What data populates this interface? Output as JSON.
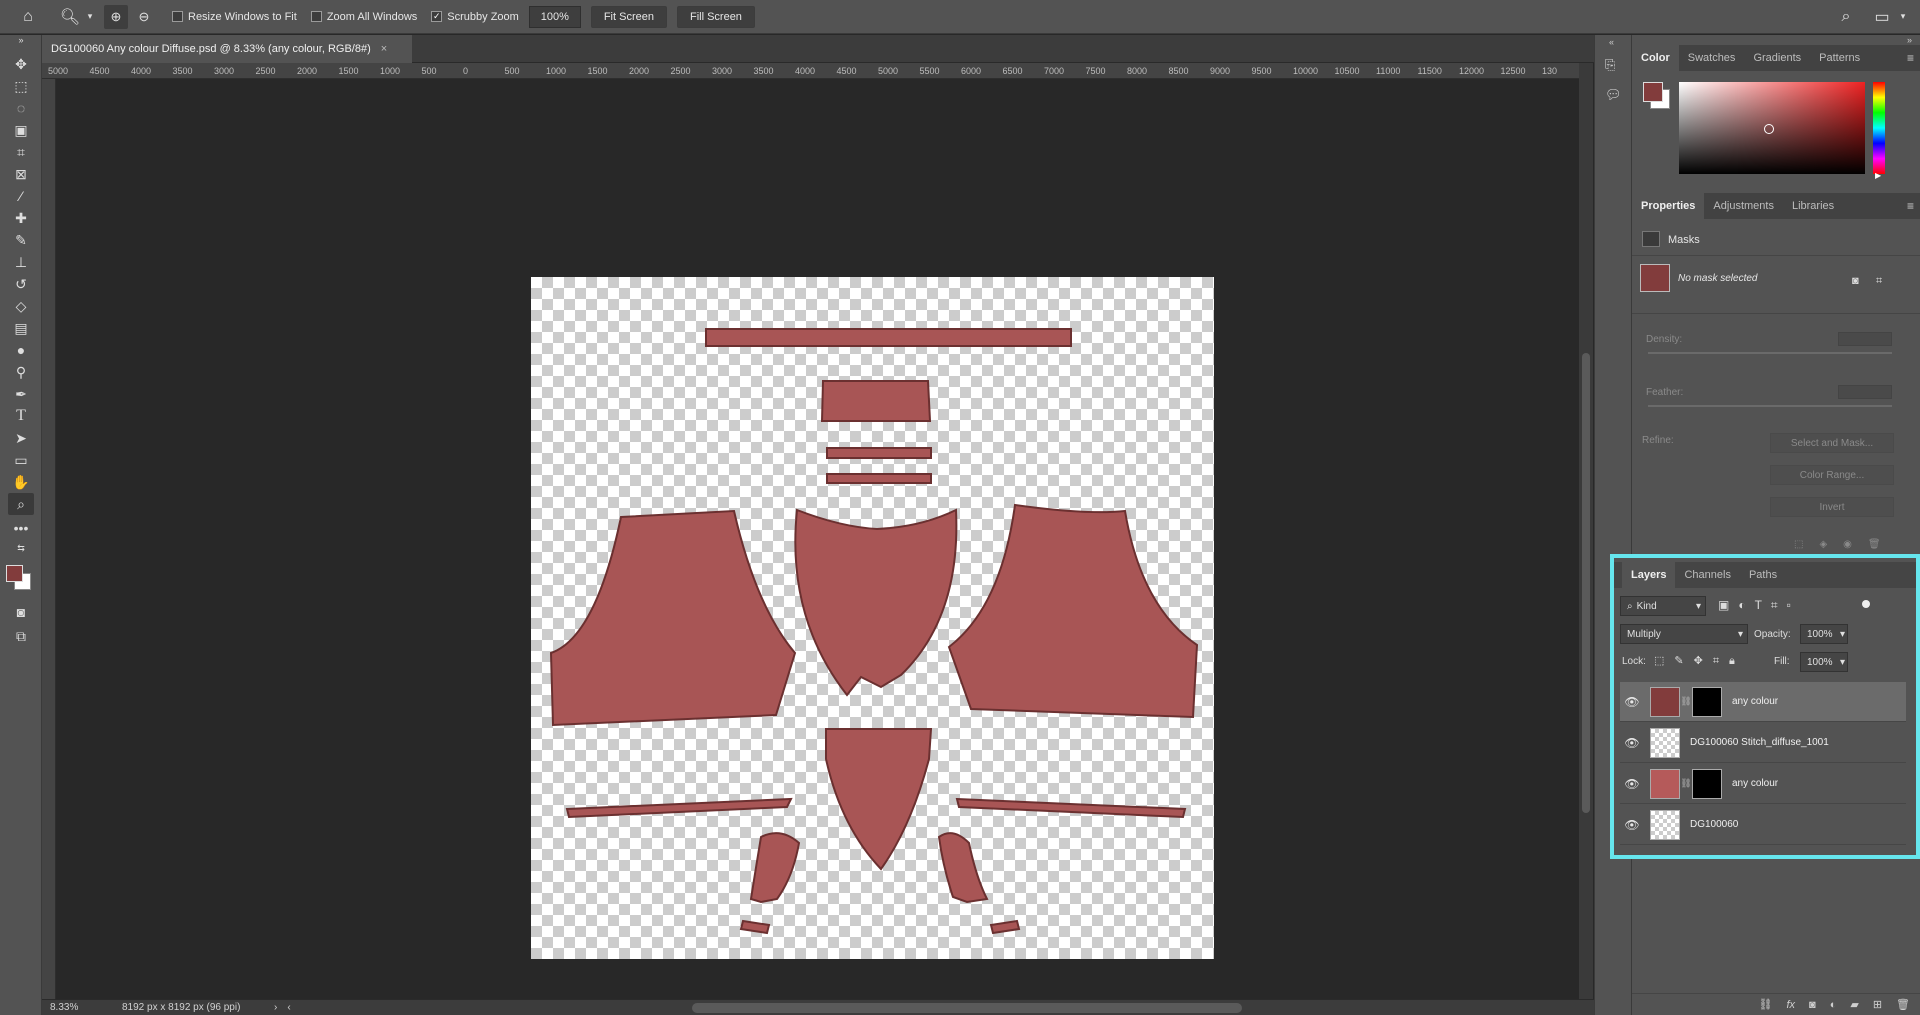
{
  "options_bar": {
    "home_icon": "home-icon",
    "zoom_tool_icon": "zoom-icon",
    "resize_windows_label": "Resize Windows to Fit",
    "resize_windows_checked": false,
    "zoom_all_windows_label": "Zoom All Windows",
    "zoom_all_windows_checked": false,
    "scrubby_zoom_label": "Scrubby Zoom",
    "scrubby_zoom_checked": true,
    "zoom_value": "100%",
    "fit_screen_label": "Fit Screen",
    "fill_screen_label": "Fill Screen"
  },
  "document_tab": {
    "title": "DG100060 Any colour Diffuse.psd @ 8.33% (any colour, RGB/8#)",
    "close": "×"
  },
  "ruler": {
    "ticks": [
      "5000",
      "4500",
      "4000",
      "3500",
      "3000",
      "2500",
      "2000",
      "1500",
      "1000",
      "500",
      "0",
      "500",
      "1000",
      "1500",
      "2000",
      "2500",
      "3000",
      "3500",
      "4000",
      "4500",
      "5000",
      "5500",
      "6000",
      "6500",
      "7000",
      "7500",
      "8000",
      "8500",
      "9000",
      "9500",
      "10000",
      "10500",
      "11000",
      "11500",
      "12000",
      "12500",
      "130"
    ]
  },
  "status_bar": {
    "zoom": "8.33%",
    "doc_size": "8192 px x 8192 px (96 ppi)"
  },
  "colors": {
    "foreground": "#823c3c",
    "background": "#ffffff",
    "fabric": "#a85555",
    "fabric_stroke": "#6b3030",
    "highlight": "#66e6ee"
  },
  "color_panel": {
    "tabs": [
      "Color",
      "Swatches",
      "Gradients",
      "Patterns"
    ],
    "active_tab": "Color"
  },
  "properties_panel": {
    "tabs": [
      "Properties",
      "Adjustments",
      "Libraries"
    ],
    "active_tab": "Properties",
    "section": "Masks",
    "no_mask_text": "No mask selected",
    "density_label": "Density:",
    "feather_label": "Feather:",
    "refine_label": "Refine:",
    "select_and_mask": "Select and Mask...",
    "color_range": "Color Range...",
    "invert": "Invert"
  },
  "layers_panel": {
    "tabs": [
      "Layers",
      "Channels",
      "Paths"
    ],
    "active_tab": "Layers",
    "filter_kind": "Kind",
    "blend_mode": "Multiply",
    "opacity_label": "Opacity:",
    "opacity_value": "100%",
    "lock_label": "Lock:",
    "fill_label": "Fill:",
    "fill_value": "100%",
    "layers": [
      {
        "name": "any colour",
        "thumb": "red",
        "has_mask": true,
        "selected": true
      },
      {
        "name": "DG100060 Stitch_diffuse_1001",
        "thumb": "chk",
        "has_mask": false,
        "selected": false
      },
      {
        "name": "any colour",
        "thumb": "red2",
        "has_mask": true,
        "selected": false
      },
      {
        "name": "DG100060",
        "thumb": "chk",
        "has_mask": false,
        "selected": false
      }
    ]
  }
}
